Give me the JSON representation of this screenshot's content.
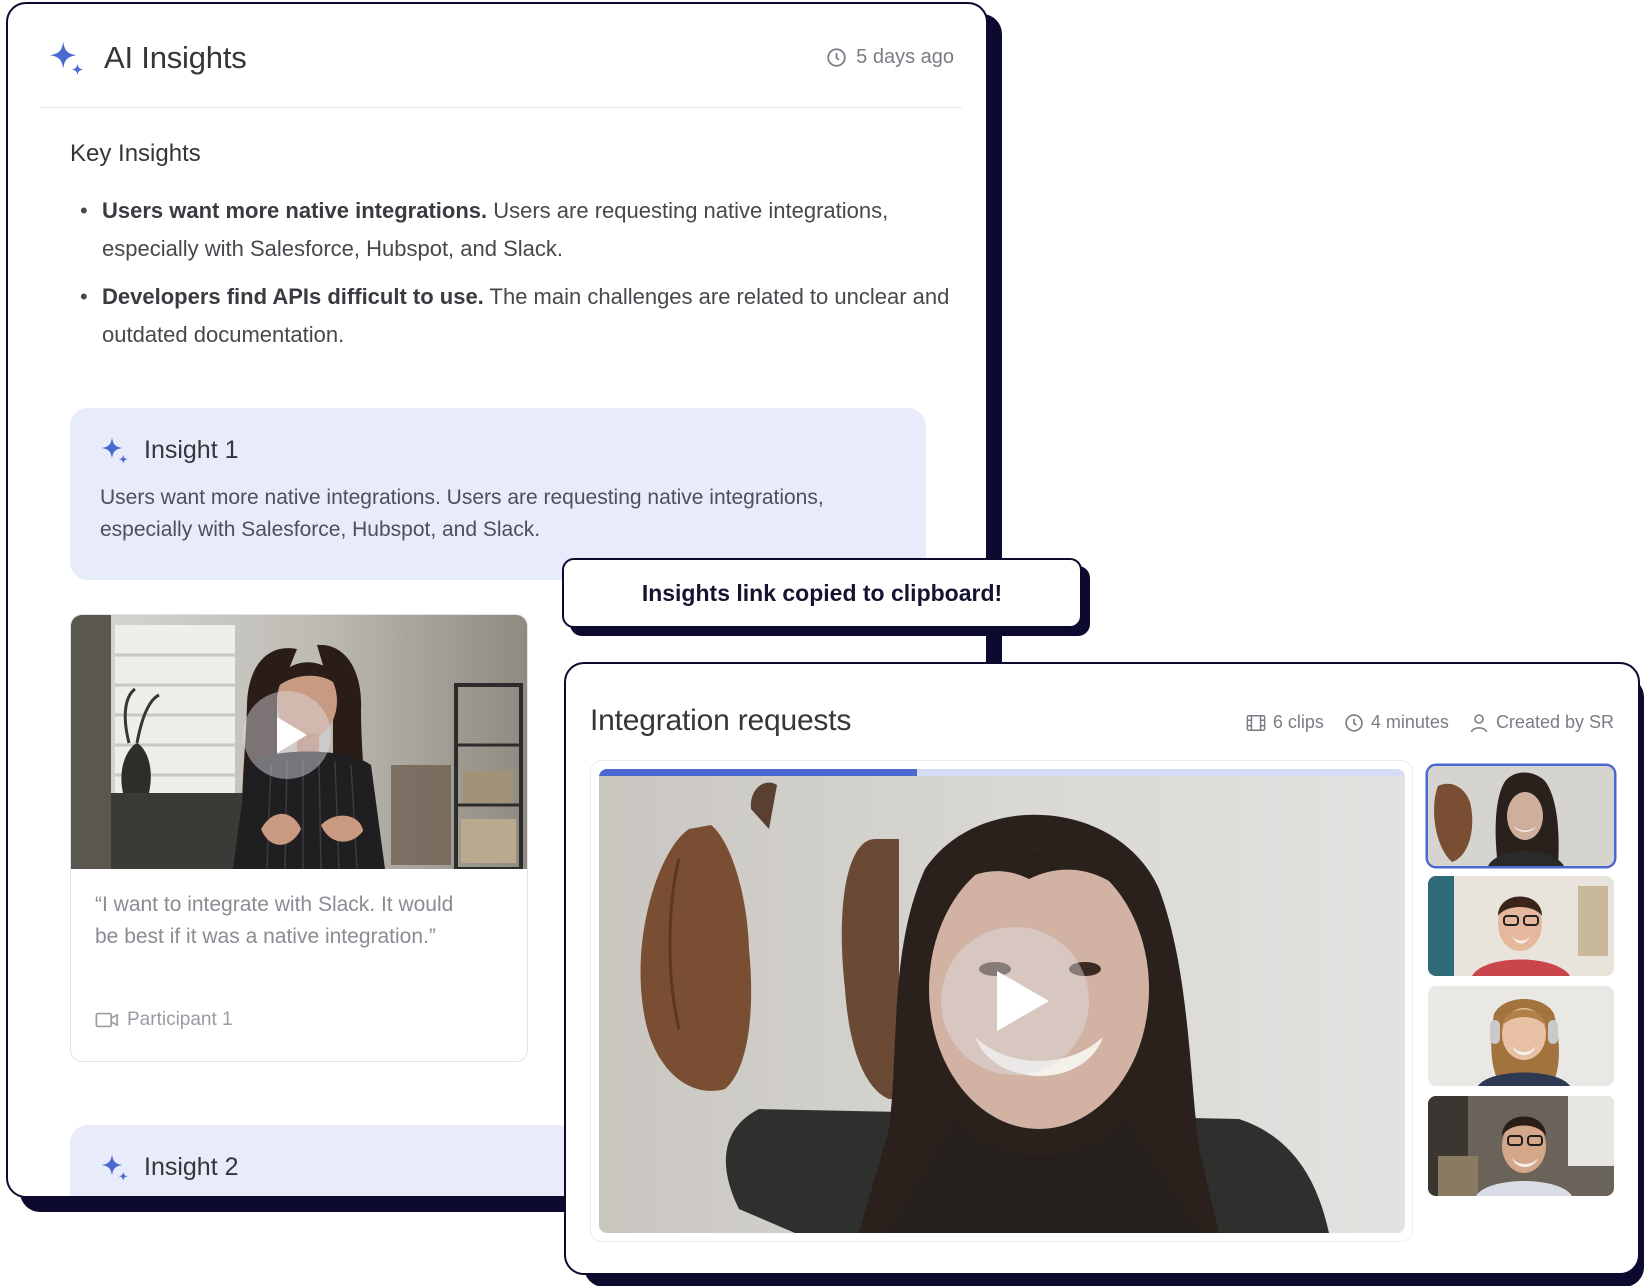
{
  "insights_panel": {
    "title": "AI Insights",
    "timestamp": "5 days ago",
    "key_insights_heading": "Key Insights",
    "key_insights": [
      {
        "bold": "Users want more native integrations.",
        "text": " Users are requesting native integrations, especially with Salesforce, Hubspot, and Slack."
      },
      {
        "bold": "Developers find APIs difficult to use.",
        "text": " The main challenges are related to unclear and outdated documentation."
      }
    ],
    "insight_1": {
      "title": "Insight 1",
      "body": "Users want more native integrations. Users are requesting native integrations, especially with Salesforce, Hubspot, and Slack."
    },
    "clip": {
      "quote": "“I want to integrate with Slack. It would be best if it was a native integration.”",
      "participant": "Participant 1"
    },
    "insight_2": {
      "title": "Insight 2"
    }
  },
  "toast": {
    "message": "Insights link copied to clipboard!"
  },
  "highlight_reel": {
    "title": "Integration requests",
    "clips": "6 clips",
    "duration": "4 minutes",
    "created_by": "Created by SR",
    "progress": 0.395,
    "thumbnails": [
      {
        "label": "participant-a",
        "active": true
      },
      {
        "label": "participant-b",
        "active": false
      },
      {
        "label": "participant-c",
        "active": false
      },
      {
        "label": "participant-d",
        "active": false
      }
    ]
  },
  "colors": {
    "accent": "#4b69d1",
    "dark_border": "#0c0a2e",
    "insight_bg": "#e7ebfa"
  },
  "icons": {
    "title_icon": "sparkle-icon",
    "time_icon": "clock-icon",
    "clips_icon": "film-icon",
    "creator_icon": "person-icon",
    "participant_icon": "video-camera-icon",
    "play_icon": "play-icon"
  }
}
